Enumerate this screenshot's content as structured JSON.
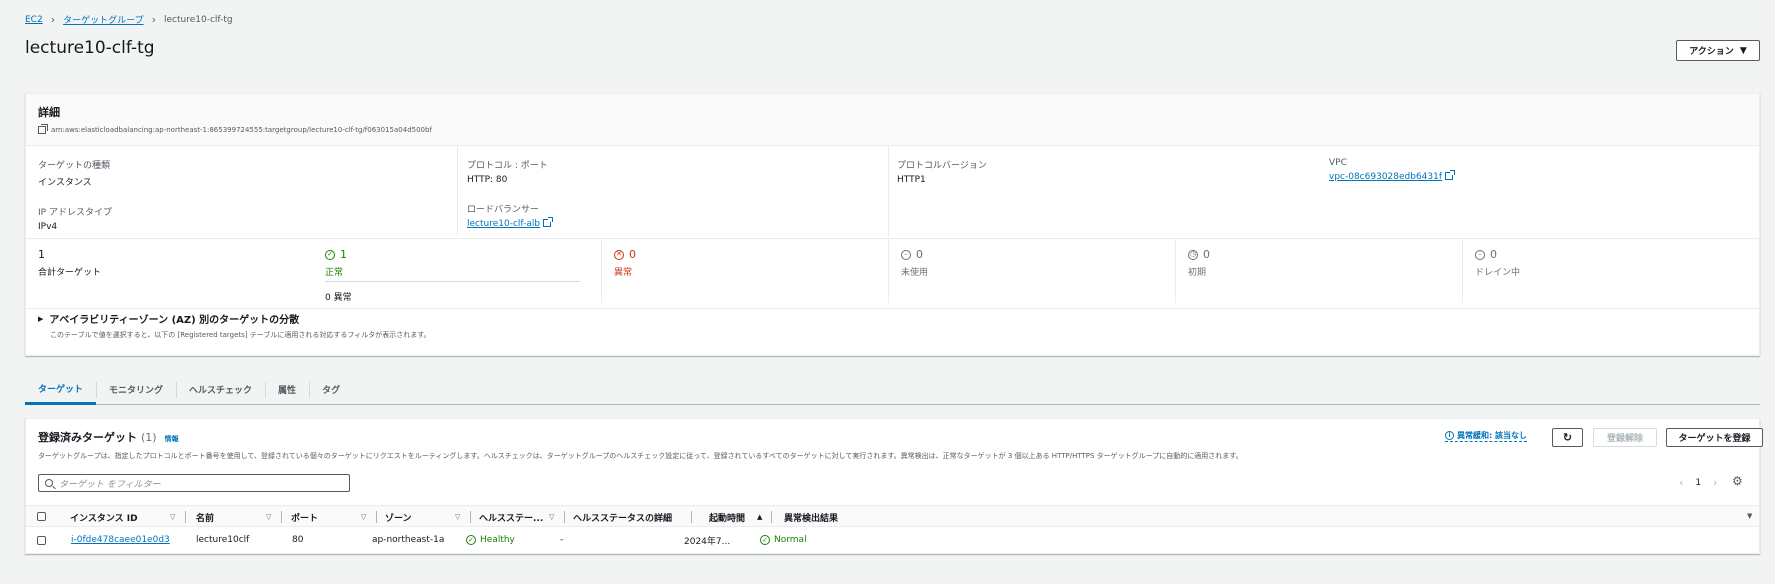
{
  "breadcrumb": {
    "items": [
      "EC2",
      "ターゲットグループ"
    ],
    "current": "lecture10-clf-tg"
  },
  "page": {
    "title": "lecture10-clf-tg",
    "action_label": "アクション"
  },
  "details": {
    "title": "詳細",
    "arn": "arn:aws:elasticloadbalancing:ap-northeast-1:865399724555:targetgroup/lecture10-clf-tg/f063015a04d500bf",
    "fields": {
      "target_type_label": "ターゲットの種類",
      "target_type_value": "インスタンス",
      "ip_type_label": "IP アドレスタイプ",
      "ip_type_value": "IPv4",
      "protocol_label": "プロトコル : ポート",
      "protocol_value": "HTTP: 80",
      "lb_label": "ロードバランサー",
      "lb_value": "lecture10-clf-alb",
      "proto_version_label": "プロトコルバージョン",
      "proto_version_value": "HTTP1",
      "vpc_label": "VPC",
      "vpc_value": "vpc-08c693028edb6431f"
    },
    "stats": {
      "total_value": "1",
      "total_label": "合計ターゲット",
      "healthy_value": "1",
      "healthy_label": "正常",
      "healthy_sub": "0 異常",
      "unhealthy_value": "0",
      "unhealthy_label": "異常",
      "unused_value": "0",
      "unused_label": "未使用",
      "initial_value": "0",
      "initial_label": "初期",
      "draining_value": "0",
      "draining_label": "ドレイン中"
    },
    "az": {
      "title": "アベイラビリティーゾーン (AZ) 別のターゲットの分散",
      "description": "このテーブルで値を選択すると、以下の [Registered targets] テーブルに適用される対応するフィルタが表示されます。"
    }
  },
  "tabs": [
    {
      "label": "ターゲット",
      "active": true
    },
    {
      "label": "モニタリング",
      "active": false
    },
    {
      "label": "ヘルスチェック",
      "active": false
    },
    {
      "label": "属性",
      "active": false
    },
    {
      "label": "タグ",
      "active": false
    }
  ],
  "targets": {
    "title": "登録済みターゲット",
    "count": "(1)",
    "info": "情報",
    "description": "ターゲットグループは、指定したプロトコルとポート番号を使用して、登録されている個々のターゲットにリクエストをルーティングします。ヘルスチェックは、ターゲットグループのヘルスチェック設定に従って、登録されているすべてのターゲットに対して実行されます。異常検出は、正常なターゲットが 3 個以上ある HTTP/HTTPS ターゲットグループに自動的に適用されます。",
    "anomaly_label": "異常緩和: 該当なし",
    "deregister_label": "登録解除",
    "register_label": "ターゲットを登録",
    "filter_placeholder": "ターゲット をフィルター",
    "page": "1",
    "columns": [
      "インスタンス ID",
      "名前",
      "ポート",
      "ゾーン",
      "ヘルスステー...",
      "ヘルスステータスの詳細",
      "起動時間",
      "異常検出結果"
    ],
    "rows": [
      {
        "instance_id": "i-0fde478caee01e0d3",
        "name": "lecture10clf",
        "port": "80",
        "zone": "ap-northeast-1a",
        "health": "Healthy",
        "health_detail": "-",
        "launch_time": "2024年7...",
        "anomaly": "Normal"
      }
    ]
  },
  "colors": {
    "link": "#0073bb",
    "success": "#1d8102",
    "error": "#d13212"
  }
}
